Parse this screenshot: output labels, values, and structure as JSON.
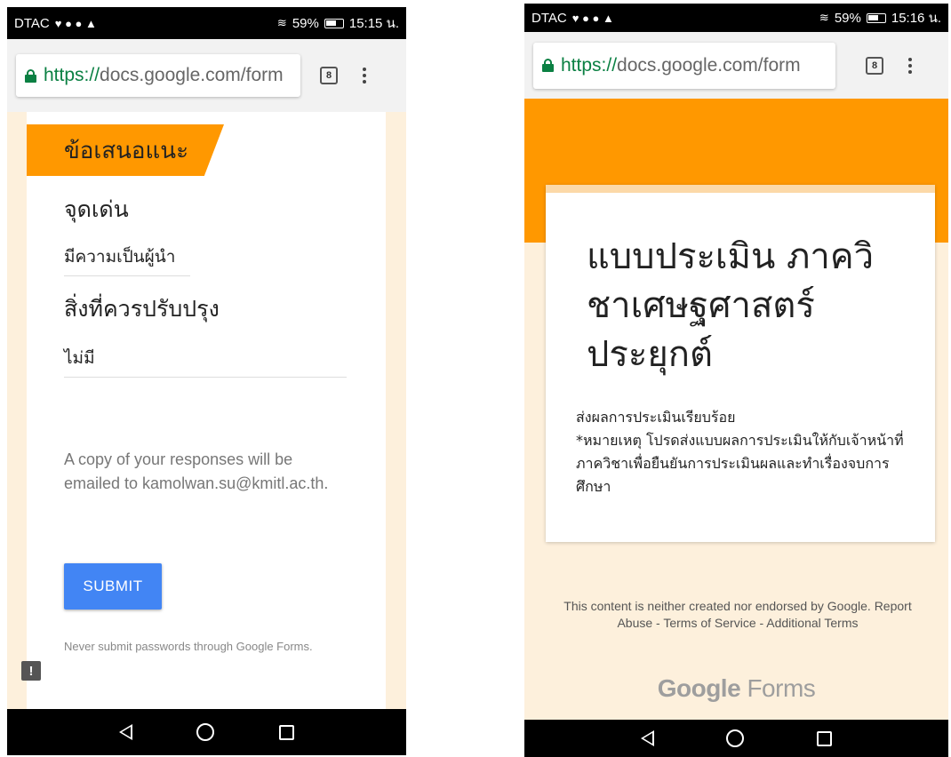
{
  "left": {
    "status": {
      "carrier": "DTAC",
      "icons": "♥ ● ● ▲",
      "signal": "59%",
      "time": "15:15 น."
    },
    "browser": {
      "url_scheme": "https://",
      "url_rest": "docs.google.com/form",
      "tab_count": "8"
    },
    "form": {
      "section_title": "ข้อเสนอแนะ",
      "question_1": "จุดเด่น",
      "answer_1": "มีความเป็นผู้นำ",
      "question_2": "สิ่งที่ควรปรับปรุง",
      "answer_2": "ไม่มี",
      "copy_note": "A copy of your responses will be emailed to kamolwan.su@kmitl.ac.th.",
      "submit_label": "SUBMIT",
      "password_note": "Never submit passwords through Google Forms.",
      "feedback_glyph": "!"
    }
  },
  "right": {
    "status": {
      "carrier": "DTAC",
      "icons": "♥ ● ● ▲",
      "signal": "59%",
      "time": "15:16 น."
    },
    "browser": {
      "url_scheme": "https://",
      "url_rest": "docs.google.com/form",
      "tab_count": "8"
    },
    "form": {
      "title": "แบบประเมิน ภาควิชาเศษฐศาสตร์ประยุกต์",
      "confirm_line_1": "ส่งผลการประเมินเรียบร้อย",
      "confirm_line_2": "*หมายเหตุ โปรดส่งแบบผลการประเมินให้กับเจ้าหน้าที่ภาควิชาเพื่อยืนยันการประเมินผลและทำเรื่องจบการศึกษา",
      "disclaimer": "This content is neither created nor endorsed by Google. Report Abuse - Terms of Service - Additional Terms",
      "logo_brand": "Google",
      "logo_product": " Forms"
    }
  },
  "colors": {
    "accent": "#ff9800",
    "submit": "#4285f4",
    "page_bg": "#fdf0dc",
    "secure": "#0b8043"
  }
}
